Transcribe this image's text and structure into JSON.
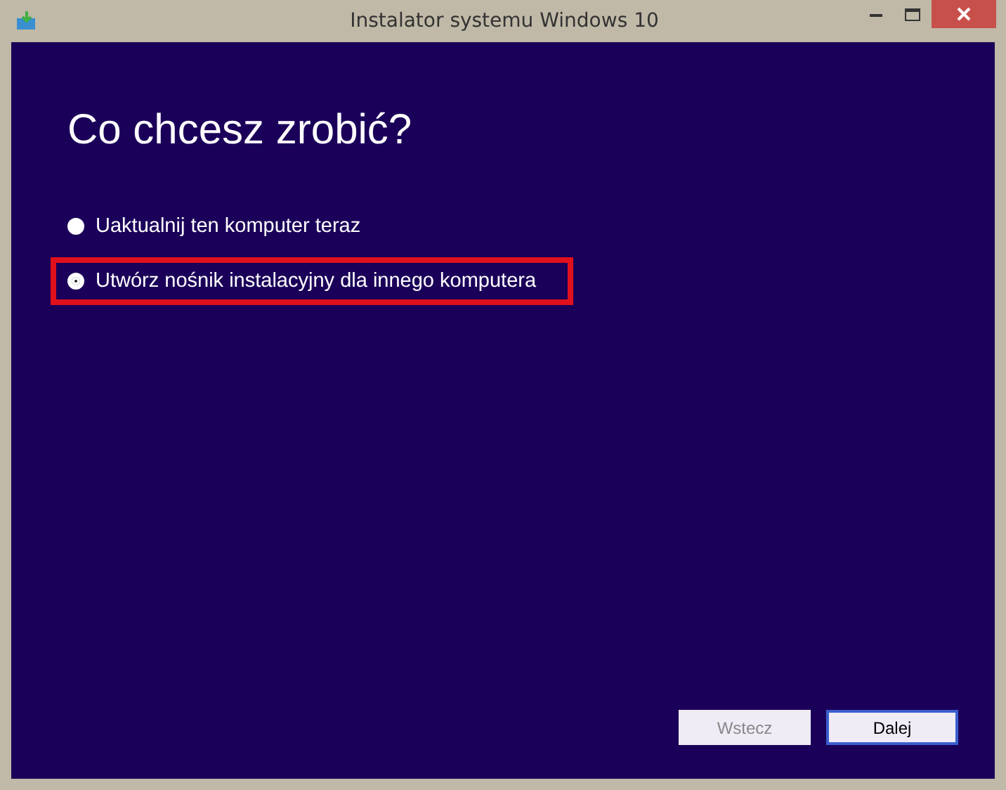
{
  "window": {
    "title": "Instalator systemu Windows 10"
  },
  "heading": "Co chcesz zrobić?",
  "options": [
    {
      "label": "Uaktualnij ten komputer teraz",
      "selected": false,
      "highlighted": false
    },
    {
      "label": "Utwórz nośnik instalacyjny dla innego komputera",
      "selected": true,
      "highlighted": true
    }
  ],
  "buttons": [
    {
      "label": "Wstecz",
      "disabled": true,
      "focused": false
    },
    {
      "label": "Dalej",
      "disabled": false,
      "focused": true
    }
  ]
}
